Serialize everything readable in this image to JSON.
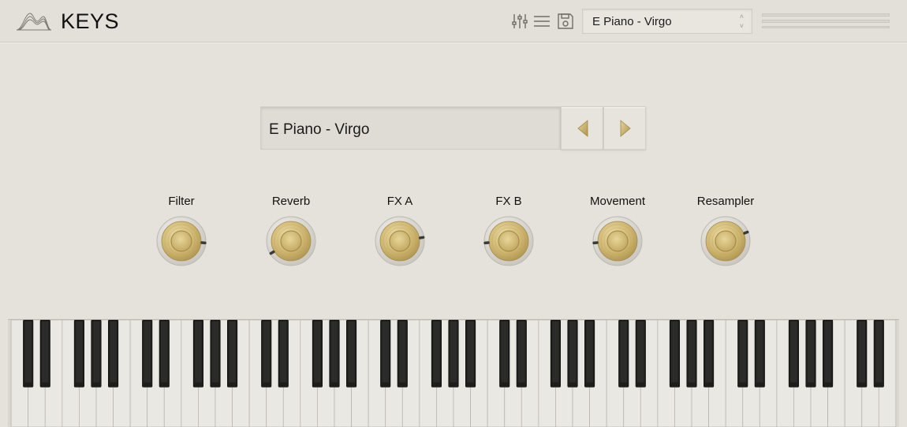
{
  "app": {
    "title": "KEYS"
  },
  "header": {
    "icons": [
      "mixer-sliders-icon",
      "menu-icon",
      "save-icon"
    ],
    "preset_select_value": "E Piano - Virgo",
    "preset_select_arrows": [
      "˄",
      "˅"
    ]
  },
  "preset": {
    "name": "E Piano - Virgo",
    "prev_icon": "triangle-left-icon",
    "next_icon": "triangle-right-icon"
  },
  "knobs": [
    {
      "label": "Filter",
      "level": 0.85
    },
    {
      "label": "Reverb",
      "level": 0.05
    },
    {
      "label": "FX A",
      "level": 0.8
    },
    {
      "label": "FX B",
      "level": 0.15
    },
    {
      "label": "Movement",
      "level": 0.15
    },
    {
      "label": "Resampler",
      "level": 0.75
    }
  ],
  "keyboard": {
    "white_keys": 52
  },
  "colors": {
    "background": "#e4e2da",
    "accent_gold": "#c9b06a",
    "text": "#1b1b1b"
  }
}
